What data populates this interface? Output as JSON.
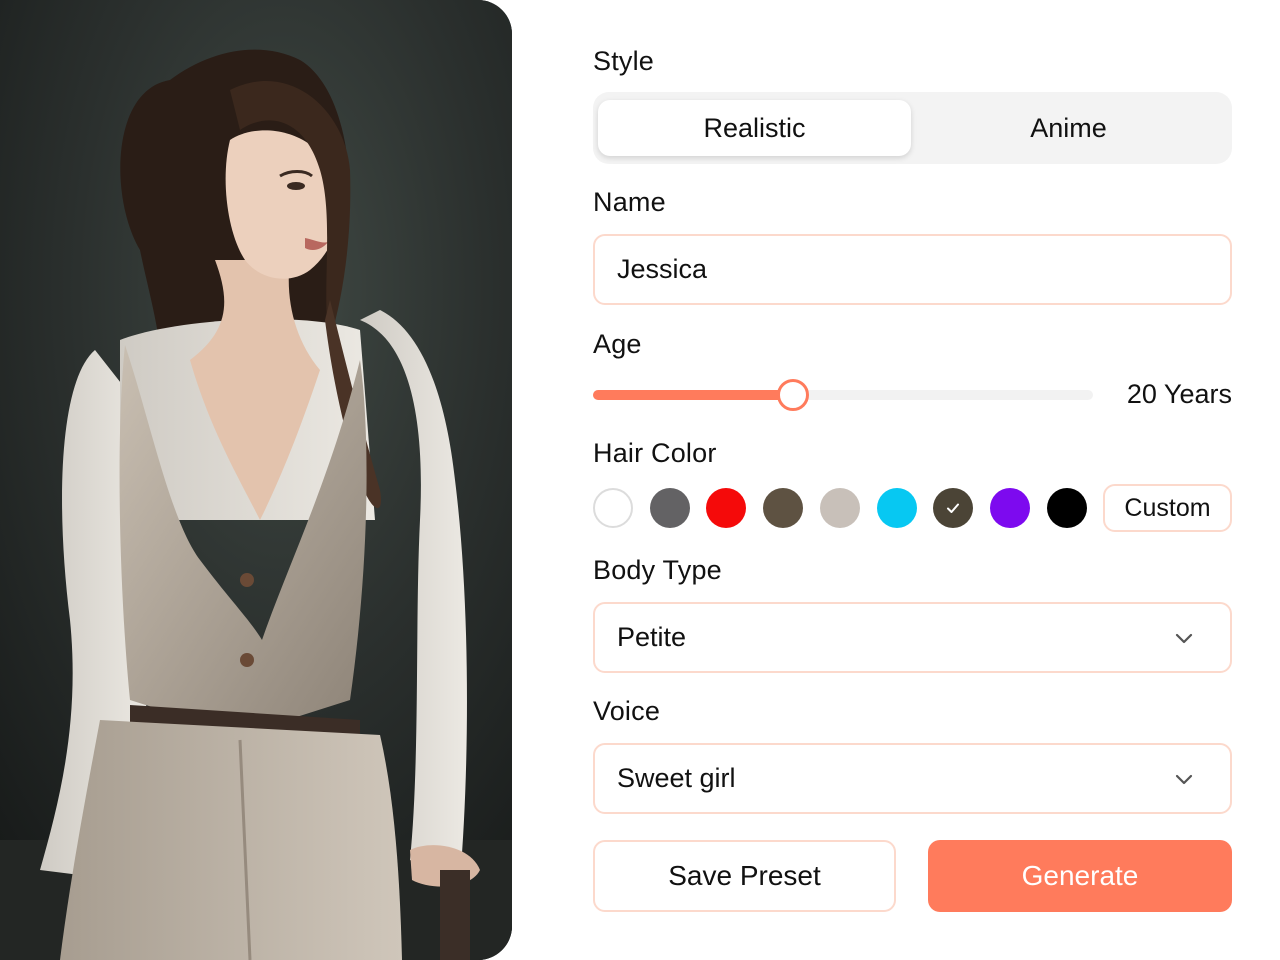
{
  "portrait": {
    "image": "realistic-woman-portrait"
  },
  "style": {
    "label": "Style",
    "options": [
      {
        "label": "Realistic",
        "active": true
      },
      {
        "label": "Anime",
        "active": false
      }
    ]
  },
  "name": {
    "label": "Name",
    "value": "Jessica"
  },
  "age": {
    "label": "Age",
    "value_text": "20 Years",
    "fraction": 0.4
  },
  "hair_color": {
    "label": "Hair Color",
    "swatches": [
      {
        "color": "#ffffff",
        "selected": false
      },
      {
        "color": "#636264",
        "selected": false
      },
      {
        "color": "#f50a0a",
        "selected": false
      },
      {
        "color": "#5e5242",
        "selected": false
      },
      {
        "color": "#c8c0b9",
        "selected": false
      },
      {
        "color": "#07c8f2",
        "selected": false
      },
      {
        "color": "#4b4436",
        "selected": true
      },
      {
        "color": "#7d0aef",
        "selected": false
      },
      {
        "color": "#000000",
        "selected": false
      }
    ],
    "custom_label": "Custom"
  },
  "body_type": {
    "label": "Body Type",
    "value": "Petite"
  },
  "voice": {
    "label": "Voice",
    "value": "Sweet girl"
  },
  "actions": {
    "save_label": "Save Preset",
    "generate_label": "Generate"
  },
  "colors": {
    "accent": "#ff7b5c",
    "border": "#fcd9cc",
    "segment_bg": "#f3f3f3"
  }
}
